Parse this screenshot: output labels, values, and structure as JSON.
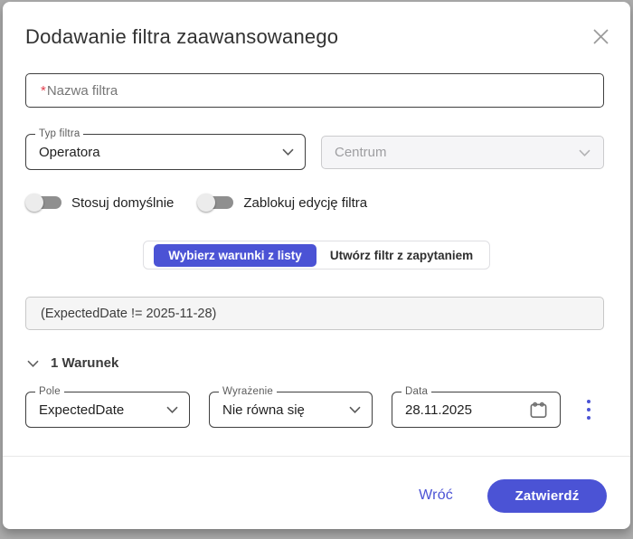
{
  "colors": {
    "accent": "#4b53d5",
    "required_mark": "#e2404f",
    "backdrop": "#ababab",
    "disabled_bg": "#f5f5f7",
    "expression_bg": "#f5f5f5"
  },
  "icons": {
    "close": "x-cross",
    "chevron_down": "chevron-down",
    "calendar": "calendar-outline",
    "more": "vertical-dots"
  },
  "dialog": {
    "title": "Dodawanie filtra zaawansowanego"
  },
  "fields": {
    "name": {
      "required_mark": "*",
      "placeholder": "Nazwa filtra",
      "value": ""
    },
    "filter_type": {
      "label": "Typ filtra",
      "value": "Operatora"
    },
    "center": {
      "value": "Centrum",
      "disabled": true
    }
  },
  "toggles": [
    {
      "label": "Stosuj domyślnie",
      "state": "off"
    },
    {
      "label": "Zablokuj edycję filtra",
      "state": "off"
    }
  ],
  "tabs": {
    "active_label": "Wybierz warunki z listy",
    "inactive_label": "Utwórz filtr z zapytaniem"
  },
  "expression": {
    "value": "(ExpectedDate != 2025-11-28)"
  },
  "conditions": {
    "header": "1 Warunek",
    "rows": [
      {
        "field": {
          "label": "Pole",
          "value": "ExpectedDate"
        },
        "operator": {
          "label": "Wyrażenie",
          "value": "Nie równa się"
        },
        "date": {
          "label": "Data",
          "value": "28.11.2025"
        }
      }
    ]
  },
  "footer": {
    "back": "Wróć",
    "submit": "Zatwierdź"
  }
}
